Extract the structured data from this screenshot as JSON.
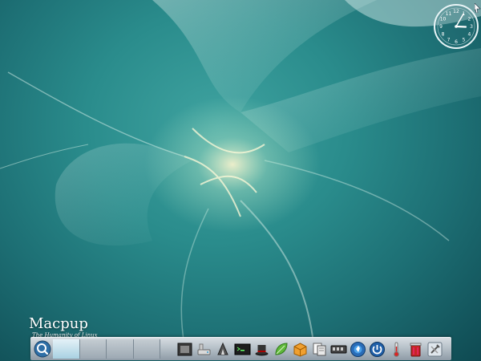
{
  "desktop": {
    "brand_title": "Macpup",
    "brand_subtitle": "The Humanity of Linux"
  },
  "clock": {
    "numerals": [
      "12",
      "1",
      "2",
      "3",
      "4",
      "5",
      "6",
      "7",
      "8",
      "9",
      "10",
      "11"
    ],
    "hour": 3,
    "minute": 5
  },
  "dock": {
    "icons": [
      "screen-capture-icon",
      "drive-icon",
      "pen-tool-icon",
      "terminal-icon",
      "hat-icon",
      "leaf-icon",
      "package-icon",
      "file-manager-icon",
      "network-icon",
      "power-icon",
      "shutdown-icon",
      "thermometer-icon",
      "trash-icon",
      "tools-icon"
    ]
  },
  "colors": {
    "wallpaper_base": "#2a8c8c",
    "taskbar": "#b7c1c9",
    "active_workspace": "#a9d1e2"
  }
}
